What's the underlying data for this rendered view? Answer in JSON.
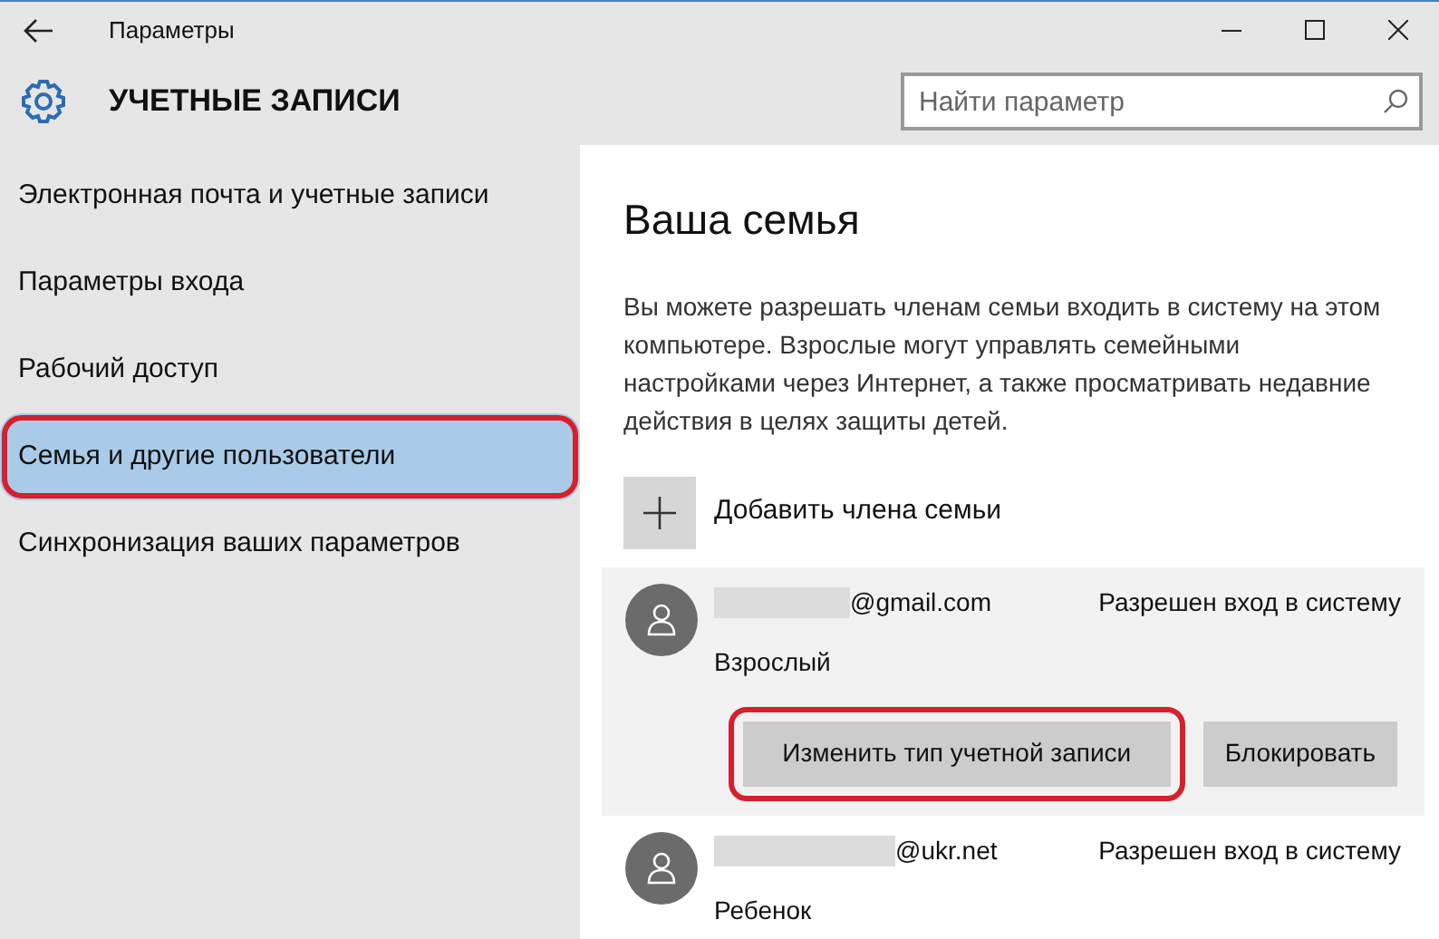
{
  "window": {
    "title": "Параметры"
  },
  "header": {
    "title": "УЧЕТНЫЕ ЗАПИСИ",
    "search": {
      "placeholder": "Найти параметр"
    }
  },
  "sidebar": {
    "items": [
      {
        "label": "Электронная почта и учетные записи",
        "selected": false,
        "highlighted": false
      },
      {
        "label": "Параметры входа",
        "selected": false,
        "highlighted": false
      },
      {
        "label": "Рабочий доступ",
        "selected": false,
        "highlighted": false
      },
      {
        "label": "Семья и другие пользователи",
        "selected": true,
        "highlighted": true
      },
      {
        "label": "Синхронизация ваших параметров",
        "selected": false,
        "highlighted": false
      }
    ]
  },
  "content": {
    "heading": "Ваша семья",
    "description": "Вы можете разрешать членам семьи входить в систему на этом компьютере. Взрослые могут управлять семейными настройками через Интернет, а также просматривать недавние действия в целях защиты детей.",
    "add_member": {
      "label": "Добавить члена семьи"
    },
    "members": [
      {
        "email": "@gmail.com",
        "status": "Разрешен вход в систему",
        "role": "Взрослый",
        "expanded": true,
        "buttons": [
          {
            "label": "Изменить тип учетной записи",
            "highlighted": true
          },
          {
            "label": "Блокировать",
            "highlighted": false
          }
        ]
      },
      {
        "email": "@ukr.net",
        "status": "Разрешен вход в систему",
        "role": "Ребенок",
        "expanded": false
      }
    ]
  }
}
